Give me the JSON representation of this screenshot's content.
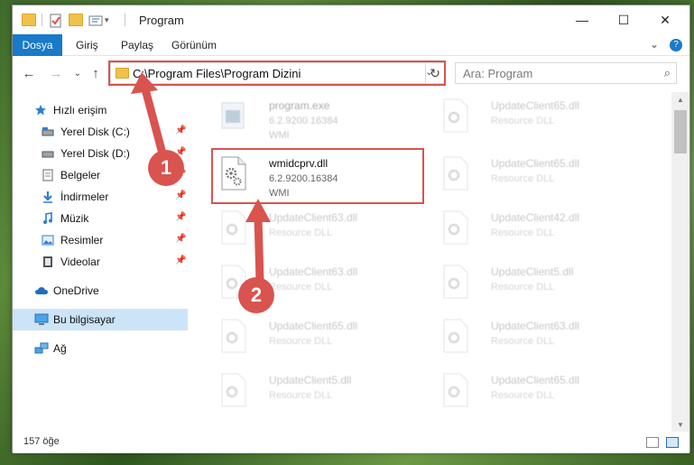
{
  "window": {
    "title": "Program",
    "minimize": "—",
    "maximize": "☐",
    "close": "✕"
  },
  "ribbon": {
    "tabs": [
      "Dosya",
      "Giriş",
      "Paylaş",
      "Görünüm"
    ],
    "expand": "⌄",
    "help": "?"
  },
  "nav": {
    "back": "←",
    "forward": "→",
    "recent": "⌄",
    "up": "↑",
    "address": "C:\\Program Files\\Program Dizini",
    "address_chevron": "⌄",
    "refresh": "↻",
    "search_placeholder": "Ara: Program",
    "search_icon": "⌕"
  },
  "sidebar": {
    "items": [
      {
        "label": "Hızlı erişim",
        "icon": "star-icon",
        "pinned": false
      },
      {
        "label": "Yerel Disk (C:)",
        "icon": "drive-icon",
        "pinned": true
      },
      {
        "label": "Yerel Disk (D:)",
        "icon": "drive-icon",
        "pinned": true
      },
      {
        "label": "Belgeler",
        "icon": "document-icon",
        "pinned": true
      },
      {
        "label": "İndirmeler",
        "icon": "download-icon",
        "pinned": true
      },
      {
        "label": "Müzik",
        "icon": "music-icon",
        "pinned": true
      },
      {
        "label": "Resimler",
        "icon": "pictures-icon",
        "pinned": true
      },
      {
        "label": "Videolar",
        "icon": "video-icon",
        "pinned": true
      },
      {
        "label": "OneDrive",
        "icon": "cloud-icon",
        "pinned": false
      },
      {
        "label": "Bu bilgisayar",
        "icon": "computer-icon",
        "pinned": false
      },
      {
        "label": "Ağ",
        "icon": "network-icon",
        "pinned": false
      }
    ],
    "pin_glyph": "📌"
  },
  "files": {
    "left": [
      {
        "name": "program.exe",
        "line1": "6.2.9200.16384",
        "line2": "WMI"
      },
      {
        "name": "wmidcprv.dll",
        "line1": "6.2.9200.16384",
        "line2": "WMI"
      },
      {
        "name": "UpdateClient63.dll",
        "line1": "Resource DLL",
        "line2": ""
      },
      {
        "name": "UpdateClient63.dll",
        "line1": "Resource DLL",
        "line2": ""
      },
      {
        "name": "UpdateClient65.dll",
        "line1": "Resource DLL",
        "line2": ""
      },
      {
        "name": "UpdateClient5.dll",
        "line1": "Resource DLL",
        "line2": ""
      }
    ],
    "right": [
      {
        "name": "UpdateClient65.dll",
        "line1": "Resource DLL"
      },
      {
        "name": "UpdateClient65.dll",
        "line1": "Resource DLL"
      },
      {
        "name": "UpdateClient42.dll",
        "line1": "Resource DLL"
      },
      {
        "name": "UpdateClient5.dll",
        "line1": "Resource DLL"
      },
      {
        "name": "UpdateClient63.dll",
        "line1": "Resource DLL"
      },
      {
        "name": "UpdateClient65.dll",
        "line1": "Resource DLL"
      }
    ]
  },
  "status": {
    "count": "157 öğe"
  },
  "annotations": {
    "step1": "1",
    "step2": "2",
    "color": "#d9534f"
  }
}
